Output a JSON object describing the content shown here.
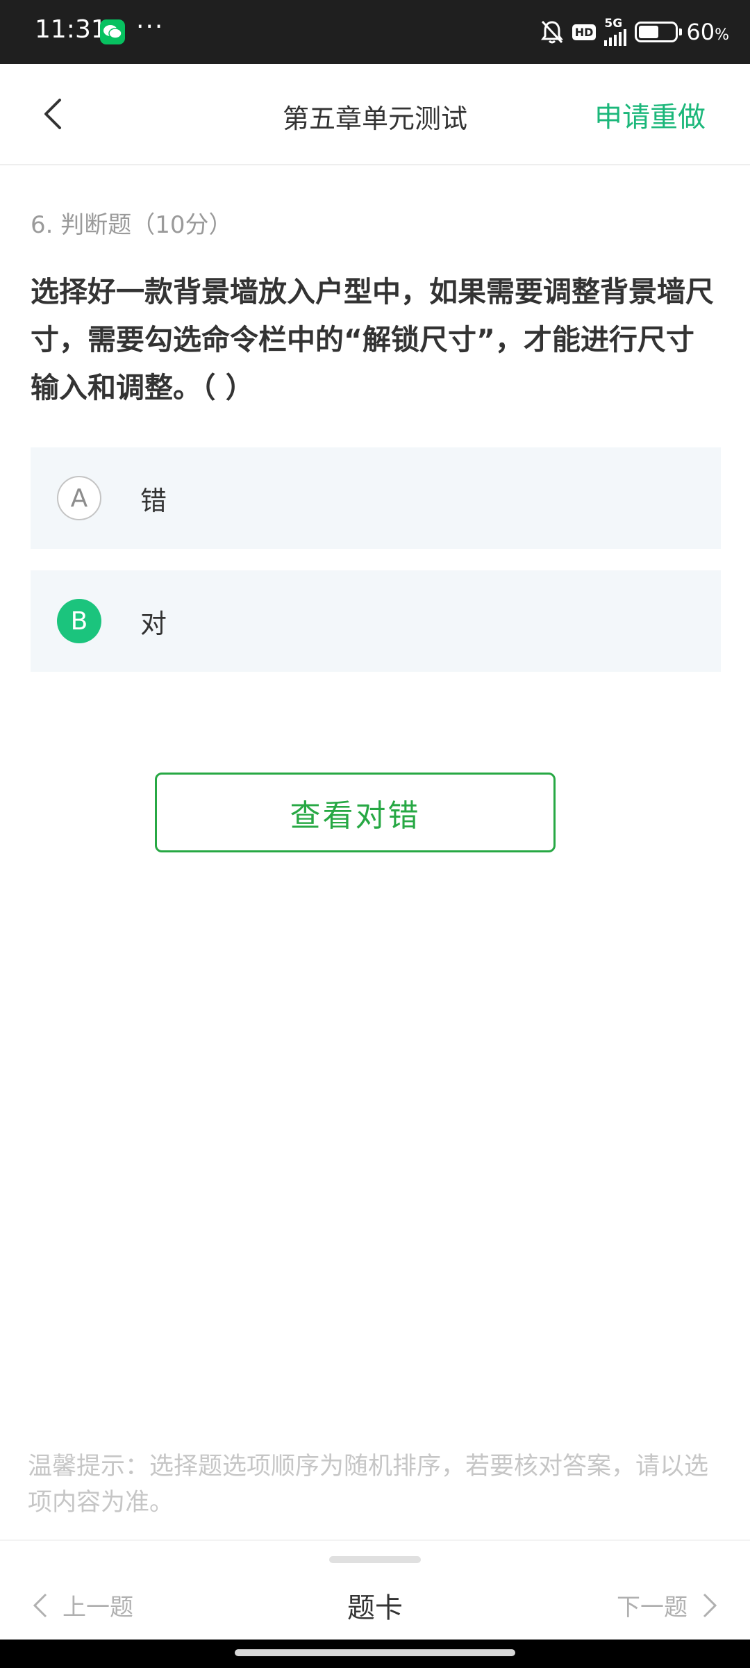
{
  "status_bar": {
    "time": "11:31",
    "more": "···",
    "hd_badge": "HD",
    "network": "5G",
    "battery": "60",
    "battery_unit": "%",
    "battery_level": 0.6,
    "icons": [
      "wechat-icon",
      "bell-muted-icon",
      "signal-icon",
      "battery-icon"
    ]
  },
  "header": {
    "title": "第五章单元测试",
    "redo_label": "申请重做",
    "back_icon": "chevron-left-icon",
    "accent_color": "#1bb77a"
  },
  "question": {
    "type_label": "6. 判断题（10分）",
    "text": "选择好一款背景墙放入户型中，如果需要调整背景墙尺寸，需要勾选命令栏中的“解锁尺寸”，才能进行尺寸输入和调整。（ ）",
    "options": [
      {
        "letter": "A",
        "text": "错",
        "selected": false
      },
      {
        "letter": "B",
        "text": "对",
        "selected": true
      }
    ],
    "selected_color": "#1bc47d"
  },
  "check_button": {
    "label": "查看对错",
    "color": "#27a844"
  },
  "tip": "温馨提示：选择题选项顺序为随机排序，若要核对答案，请以选项内容为准。",
  "bottom_bar": {
    "prev_label": "上一题",
    "card_label": "题卡",
    "next_label": "下一题"
  }
}
